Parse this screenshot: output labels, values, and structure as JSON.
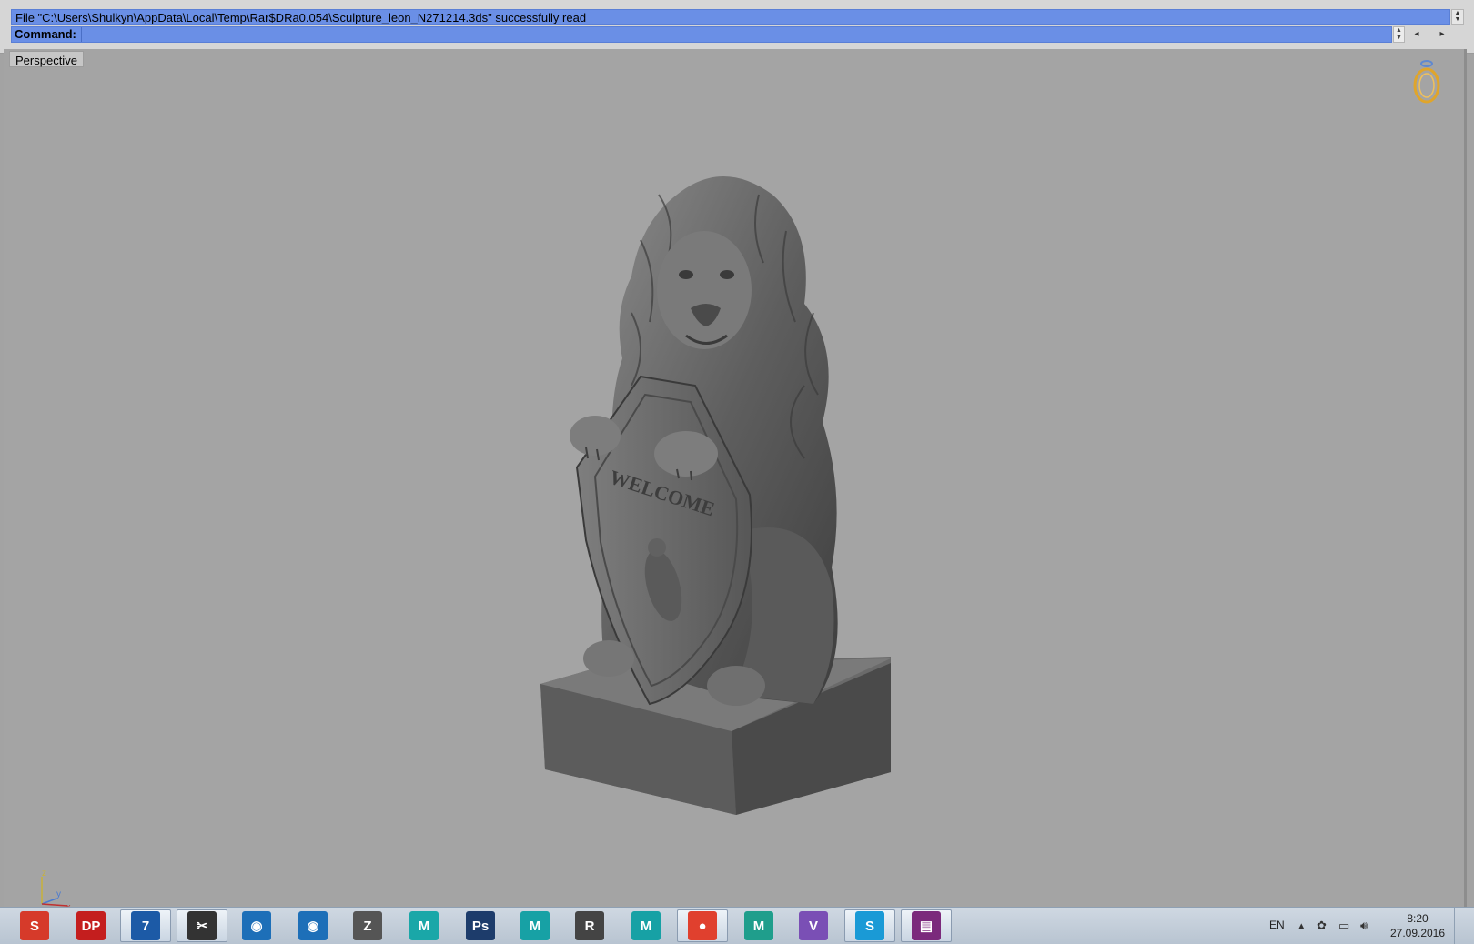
{
  "command_area": {
    "history_text": "File \"C:\\Users\\Shulkyn\\AppData\\Local\\Temp\\Rar$DRa0.054\\Sculpture_leon_N271214.3ds\" successfully read",
    "command_label": "Command:",
    "command_value": ""
  },
  "viewport": {
    "label": "Perspective",
    "shield_text": "WELCOME",
    "axes": {
      "z": "z",
      "y": "y",
      "x": "x"
    }
  },
  "taskbar": {
    "apps": [
      {
        "name": "sketchup-icon",
        "glyph": "S",
        "color": "#d63a2a"
      },
      {
        "name": "dp-icon",
        "glyph": "DP",
        "color": "#c41e1e"
      },
      {
        "name": "3d-coat-icon",
        "glyph": "7",
        "color": "#1c5aa6"
      },
      {
        "name": "tool-icon",
        "glyph": "✂",
        "color": "#333333"
      },
      {
        "name": "keyshot-icon",
        "glyph": "◉",
        "color": "#1d6fb8"
      },
      {
        "name": "keyshot2-icon",
        "glyph": "◉",
        "color": "#1d6fb8"
      },
      {
        "name": "zbrush-icon",
        "glyph": "Z",
        "color": "#555555"
      },
      {
        "name": "3ds-max-icon",
        "glyph": "M",
        "color": "#1aa7a8"
      },
      {
        "name": "photoshop-icon",
        "glyph": "Ps",
        "color": "#1d3c6b"
      },
      {
        "name": "maya-icon",
        "glyph": "M",
        "color": "#17a1a5"
      },
      {
        "name": "rhino-icon",
        "glyph": "R",
        "color": "#444444"
      },
      {
        "name": "maya2-icon",
        "glyph": "M",
        "color": "#17a1a5"
      },
      {
        "name": "chrome-icon",
        "glyph": "●",
        "color": "#e0402e"
      },
      {
        "name": "mudbox-icon",
        "glyph": "M",
        "color": "#1f9e8c"
      },
      {
        "name": "viber-icon",
        "glyph": "V",
        "color": "#7a4fb5"
      },
      {
        "name": "skype-icon",
        "glyph": "S",
        "color": "#1a9ad6"
      },
      {
        "name": "winrar-icon",
        "glyph": "▤",
        "color": "#7b2a7c"
      }
    ],
    "language": "EN",
    "time": "8:20",
    "date": "27.09.2016"
  }
}
